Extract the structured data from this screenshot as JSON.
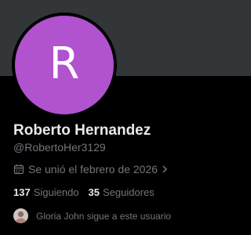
{
  "colors": {
    "banner": "#333639",
    "background": "#000000",
    "avatar": "#b152cf",
    "primary_text": "#e7e9ea",
    "secondary_text": "#71767b"
  },
  "profile": {
    "avatar_letter": "R",
    "display_name": "Roberto Hernandez",
    "handle": "@RobertoHer3129",
    "joined": "Se unió el febrero de 2026",
    "joined_icon": "calendar-icon"
  },
  "stats": {
    "following_count": "137",
    "following_label": "Siguiendo",
    "followers_count": "35",
    "followers_label": "Seguidores"
  },
  "followed_by": {
    "text": "Gloria John sigue a este usuario"
  }
}
